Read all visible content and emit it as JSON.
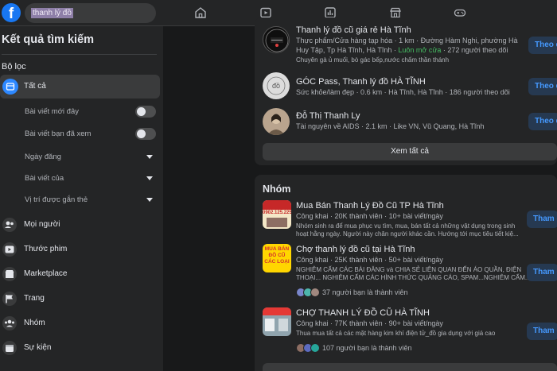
{
  "search": {
    "query": "thanh lý đồ"
  },
  "sidebar": {
    "title": "Kết quả tìm kiếm",
    "filter_heading": "Bộ lọc",
    "active": {
      "label": "Tất cả"
    },
    "sub_items": [
      {
        "label": "Bài viết mới đây",
        "control": "toggle"
      },
      {
        "label": "Bài viết bạn đã xem",
        "control": "toggle"
      },
      {
        "label": "Ngày đăng",
        "control": "dropdown"
      },
      {
        "label": "Bài viết của",
        "control": "dropdown"
      },
      {
        "label": "Vị trí được gắn thẻ",
        "control": "dropdown"
      }
    ],
    "main_items": [
      {
        "label": "Mọi người",
        "icon": "people-icon"
      },
      {
        "label": "Thước phim",
        "icon": "video-icon"
      },
      {
        "label": "Marketplace",
        "icon": "marketplace-icon"
      },
      {
        "label": "Trang",
        "icon": "flag-icon"
      },
      {
        "label": "Nhóm",
        "icon": "groups-icon"
      },
      {
        "label": "Sự kiện",
        "icon": "calendar-icon"
      }
    ]
  },
  "pages": {
    "items": [
      {
        "title": "Thanh lý đồ cũ giá rẻ Hà Tĩnh",
        "line1": "Thực phẩm/Cửa hàng tạp hóa · 1 km · Đường Hàm Nghi, phường Hà",
        "line2_prefix": "Huy Tập, Tp Hà Tĩnh, Hà Tĩnh · ",
        "line2_open": "Luôn mở cửa",
        "line2_suffix": " · 272 người theo dõi",
        "line3": "Chuyên gà ủ muối, bò gác bếp,nước chấm thần thánh",
        "button": "Theo dõi"
      },
      {
        "title": "GÓC Pass, Thanh lý đồ HÀ TĨNH",
        "line1": "Sức khỏe/làm đẹp · 0.6 km · Hà Tĩnh, Hà Tĩnh · 186 người theo dõi",
        "button": "Theo dõi"
      },
      {
        "title": "Đỗ Thị Thanh Ly",
        "line1": "Tài nguyên về AIDS · 2.1 km · Like VN, Vũ Quang, Hà Tĩnh",
        "button": "Theo dõi"
      }
    ],
    "see_all": "Xem tất cả"
  },
  "groups": {
    "heading": "Nhóm",
    "items": [
      {
        "title": "Mua Bán Thanh Lý Đồ Cũ TP Hà Tĩnh",
        "meta": "Công khai · 20K thành viên · 10+ bài viết/ngày",
        "desc1": "Nhóm sinh ra để mua phục vụ tìm, mua, bán tất cả những vật dụng trong sinh",
        "desc2": "hoạt hằng ngày. Người này chân người khác cần. Hướng tới mục tiêu tiết kiệ...",
        "thumb_phone": "0902.125.225",
        "button": "Tham gia"
      },
      {
        "title": "Chợ thanh lý đồ cũ tại Hà Tĩnh",
        "meta": "Công khai · 25K thành viên · 50+ bài viết/ngày",
        "desc1": "NGHIÊM CẤM CÁC BÀI ĐĂNG và CHIA SẺ LIÊN QUAN ĐẾN ÁO QUẦN, ĐIỆN",
        "desc2": "THOẠI... NGHIÊM CẤM CÁC HÌNH THỨC QUẢNG CÁO, SPAM...NGHIÊM CẤM...",
        "friends": "37 người bạn là thành viên",
        "thumb_text": "MUA BÁN ĐỒ CŨ CÁC LOẠI",
        "button": "Tham gia"
      },
      {
        "title": "CHỢ THANH LÝ ĐỒ CŨ HÀ TĨNH",
        "meta": "Công khai · 77K thành viên · 90+ bài viết/ngày",
        "desc1": "Thua mua tất cả các mặt hàng kim khí điện tử_đồ gia dụng với giá cao",
        "friends": "107 người bạn là thành viên",
        "button": "Tham gia"
      }
    ]
  },
  "colors": {
    "accent": "#1877f2",
    "button_bg": "#263951",
    "button_text": "#4599ff",
    "status_open": "#45bd62"
  }
}
